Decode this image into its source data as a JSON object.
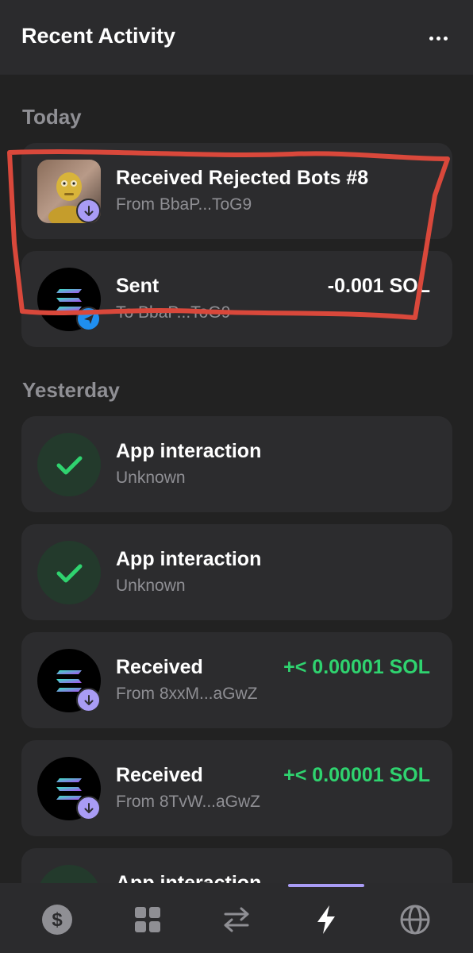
{
  "header": {
    "title": "Recent Activity",
    "menu_icon": "more-horizontal-icon"
  },
  "sections": {
    "today": "Today",
    "yesterday": "Yesterday"
  },
  "items": [
    {
      "title": "Received Rejected Bots #8",
      "subtitle": "From BbaP...ToG9",
      "amount": "",
      "avatar": "nft-image",
      "badge": "receive-arrow-icon"
    },
    {
      "title": "Sent",
      "subtitle": "To BbaP...ToG9",
      "amount": "-0.001 SOL",
      "avatar": "solana-logo",
      "badge": "send-arrow-icon"
    },
    {
      "title": "App interaction",
      "subtitle": "Unknown",
      "amount": "",
      "avatar": "checkmark-icon",
      "badge": ""
    },
    {
      "title": "App interaction",
      "subtitle": "Unknown",
      "amount": "",
      "avatar": "checkmark-icon",
      "badge": ""
    },
    {
      "title": "Received",
      "subtitle": "From 8xxM...aGwZ",
      "amount": "+< 0.00001 SOL",
      "avatar": "solana-logo",
      "badge": "receive-arrow-icon"
    },
    {
      "title": "Received",
      "subtitle": "From 8TvW...aGwZ",
      "amount": "+< 0.00001 SOL",
      "avatar": "solana-logo",
      "badge": "receive-arrow-icon"
    },
    {
      "title": "App interaction",
      "subtitle": "",
      "amount": "",
      "avatar": "checkmark-icon",
      "badge": ""
    }
  ],
  "tabbar": {
    "tabs": [
      "dollar-icon",
      "grid-icon",
      "swap-icon",
      "lightning-icon",
      "globe-icon"
    ],
    "active": "lightning-icon"
  },
  "colors": {
    "background": "#222222",
    "card": "#2c2c2e",
    "positive": "#2fd36f",
    "accent": "#a99cf5",
    "annotation": "#d9483b"
  }
}
